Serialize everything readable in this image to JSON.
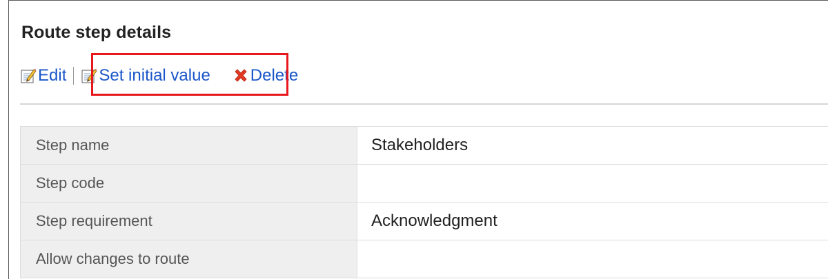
{
  "page": {
    "title": "Route step details"
  },
  "actions": {
    "edit_label": "Edit",
    "set_initial_value_label": "Set initial value",
    "delete_label": "Delete",
    "icons": {
      "edit": "edit-pencil-icon",
      "set_initial_value": "edit-pencil-icon",
      "delete": "red-x-delete-icon"
    }
  },
  "details": {
    "rows": [
      {
        "label": "Step name",
        "value": "Stakeholders"
      },
      {
        "label": "Step code",
        "value": ""
      },
      {
        "label": "Step requirement",
        "value": "Acknowledgment"
      },
      {
        "label": "Allow changes to route",
        "value": ""
      }
    ]
  },
  "colors": {
    "link": "#1a56c9",
    "highlight_box": "#e8171c",
    "label_cell_bg": "#efefef"
  }
}
